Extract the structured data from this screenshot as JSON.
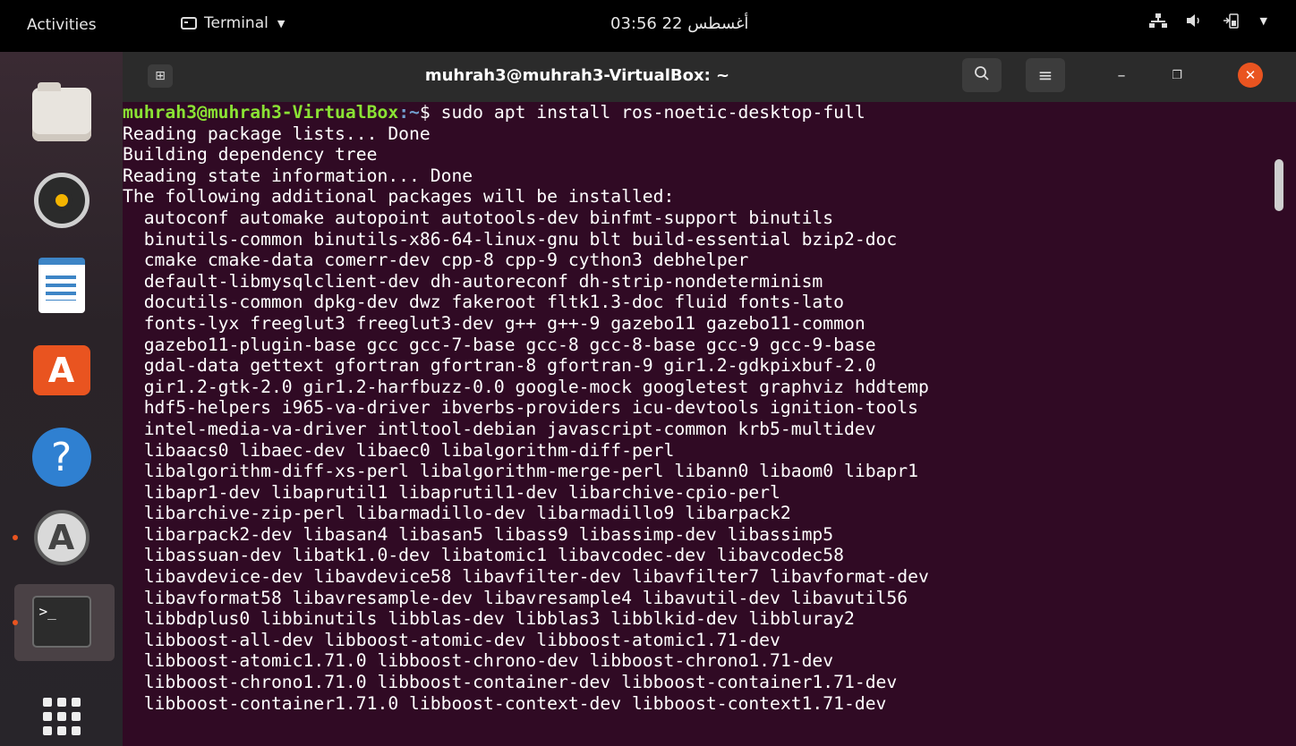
{
  "topbar": {
    "activities": "Activities",
    "app_menu": "Terminal",
    "clock": "أغسطس 22  03:56"
  },
  "dock": {
    "items": [
      "files",
      "rhythmbox",
      "libreoffice-writer",
      "ubuntu-software",
      "help",
      "software-updater",
      "terminal",
      "show-applications"
    ]
  },
  "window": {
    "title": "muhrah3@muhrah3-VirtualBox: ~"
  },
  "terminal": {
    "prompt_user": "muhrah3@muhrah3-VirtualBox",
    "prompt_path": ":~",
    "prompt_suffix": "$ ",
    "command": "sudo apt install ros-noetic-desktop-full",
    "output": [
      "Reading package lists... Done",
      "Building dependency tree",
      "Reading state information... Done",
      "The following additional packages will be installed:",
      "  autoconf automake autopoint autotools-dev binfmt-support binutils",
      "  binutils-common binutils-x86-64-linux-gnu blt build-essential bzip2-doc",
      "  cmake cmake-data comerr-dev cpp-8 cpp-9 cython3 debhelper",
      "  default-libmysqlclient-dev dh-autoreconf dh-strip-nondeterminism",
      "  docutils-common dpkg-dev dwz fakeroot fltk1.3-doc fluid fonts-lato",
      "  fonts-lyx freeglut3 freeglut3-dev g++ g++-9 gazebo11 gazebo11-common",
      "  gazebo11-plugin-base gcc gcc-7-base gcc-8 gcc-8-base gcc-9 gcc-9-base",
      "  gdal-data gettext gfortran gfortran-8 gfortran-9 gir1.2-gdkpixbuf-2.0",
      "  gir1.2-gtk-2.0 gir1.2-harfbuzz-0.0 google-mock googletest graphviz hddtemp",
      "  hdf5-helpers i965-va-driver ibverbs-providers icu-devtools ignition-tools",
      "  intel-media-va-driver intltool-debian javascript-common krb5-multidev",
      "  libaacs0 libaec-dev libaec0 libalgorithm-diff-perl",
      "  libalgorithm-diff-xs-perl libalgorithm-merge-perl libann0 libaom0 libapr1",
      "  libapr1-dev libaprutil1 libaprutil1-dev libarchive-cpio-perl",
      "  libarchive-zip-perl libarmadillo-dev libarmadillo9 libarpack2",
      "  libarpack2-dev libasan4 libasan5 libass9 libassimp-dev libassimp5",
      "  libassuan-dev libatk1.0-dev libatomic1 libavcodec-dev libavcodec58",
      "  libavdevice-dev libavdevice58 libavfilter-dev libavfilter7 libavformat-dev",
      "  libavformat58 libavresample-dev libavresample4 libavutil-dev libavutil56",
      "  libbdplus0 libbinutils libblas-dev libblas3 libblkid-dev libbluray2",
      "  libboost-all-dev libboost-atomic-dev libboost-atomic1.71-dev",
      "  libboost-atomic1.71.0 libboost-chrono-dev libboost-chrono1.71-dev",
      "  libboost-chrono1.71.0 libboost-container-dev libboost-container1.71-dev",
      "  libboost-container1.71.0 libboost-context-dev libboost-context1.71-dev"
    ]
  }
}
